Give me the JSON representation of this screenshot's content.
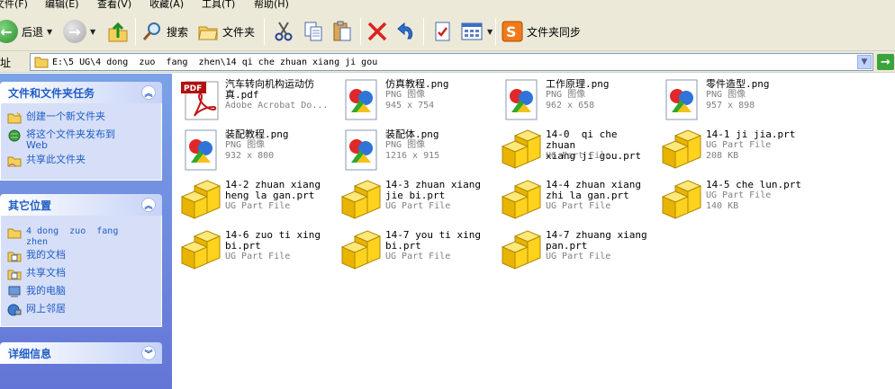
{
  "menu": [
    "文件(F)",
    "编辑(E)",
    "查看(V)",
    "收藏(A)",
    "工具(T)",
    "帮助(H)"
  ],
  "toolbar": {
    "back_label": "后退",
    "search_label": "搜索",
    "folders_label": "文件夹",
    "sync_label": "文件夹同步"
  },
  "address": {
    "label": "地址",
    "path": "E:\\5 UG\\4 dong  zuo  fang  zhen\\14 qi che zhuan xiang ji gou"
  },
  "sidebar": {
    "tasks_title": "文件和文件夹任务",
    "tasks": [
      "创建一个新文件夹",
      "将这个文件夹发布到\nWeb",
      "共享此文件夹"
    ],
    "places_title": "其它位置",
    "places": [
      "4 dong  zuo  fang\nzhen",
      "我的文档",
      "共享文档",
      "我的电脑",
      "网上邻居"
    ],
    "details_title": "详细信息"
  },
  "files": [
    {
      "name": "汽车转向机构运动仿\n真.pdf",
      "type": "Adobe Acrobat Do...",
      "size": "",
      "icon": "pdf-icon"
    },
    {
      "name": "仿真教程.png",
      "type": "PNG 图像",
      "size": "945 x 754",
      "icon": "png-icon"
    },
    {
      "name": "工作原理.png",
      "type": "PNG 图像",
      "size": "962 x 658",
      "icon": "png-icon"
    },
    {
      "name": "零件造型.png",
      "type": "PNG 图像",
      "size": "957 x 898",
      "icon": "png-icon"
    },
    {
      "name": "装配教程.png",
      "type": "PNG 图像",
      "size": "932 x 800",
      "icon": "png-icon"
    },
    {
      "name": "装配体.png",
      "type": "PNG 图像",
      "size": "1216 x 915",
      "icon": "png-icon"
    },
    {
      "name": "14-0  qi che zhuan\nxiang ji gou.prt",
      "type": "UG Part File",
      "size": "",
      "icon": "ug-part-icon"
    },
    {
      "name": "14-1 ji jia.prt",
      "type": "UG Part File",
      "size": "208 KB",
      "icon": "ug-part-icon"
    },
    {
      "name": "14-2 zhuan xiang\nheng la gan.prt",
      "type": "UG Part File",
      "size": "",
      "icon": "ug-part-icon"
    },
    {
      "name": "14-3 zhuan xiang\njie bi.prt",
      "type": "UG Part File",
      "size": "",
      "icon": "ug-part-icon"
    },
    {
      "name": "14-4 zhuan xiang\nzhi la gan.prt",
      "type": "UG Part File",
      "size": "",
      "icon": "ug-part-icon"
    },
    {
      "name": "14-5 che lun.prt",
      "type": "UG Part File",
      "size": "140 KB",
      "icon": "ug-part-icon"
    },
    {
      "name": "14-6 zuo ti xing\nbi.prt",
      "type": "UG Part File",
      "size": "",
      "icon": "ug-part-icon"
    },
    {
      "name": "14-7 you ti xing\nbi.prt",
      "type": "UG Part File",
      "size": "",
      "icon": "ug-part-icon"
    },
    {
      "name": "14-7 zhuang xiang\npan.prt",
      "type": "UG Part File",
      "size": "",
      "icon": "ug-part-icon"
    }
  ]
}
